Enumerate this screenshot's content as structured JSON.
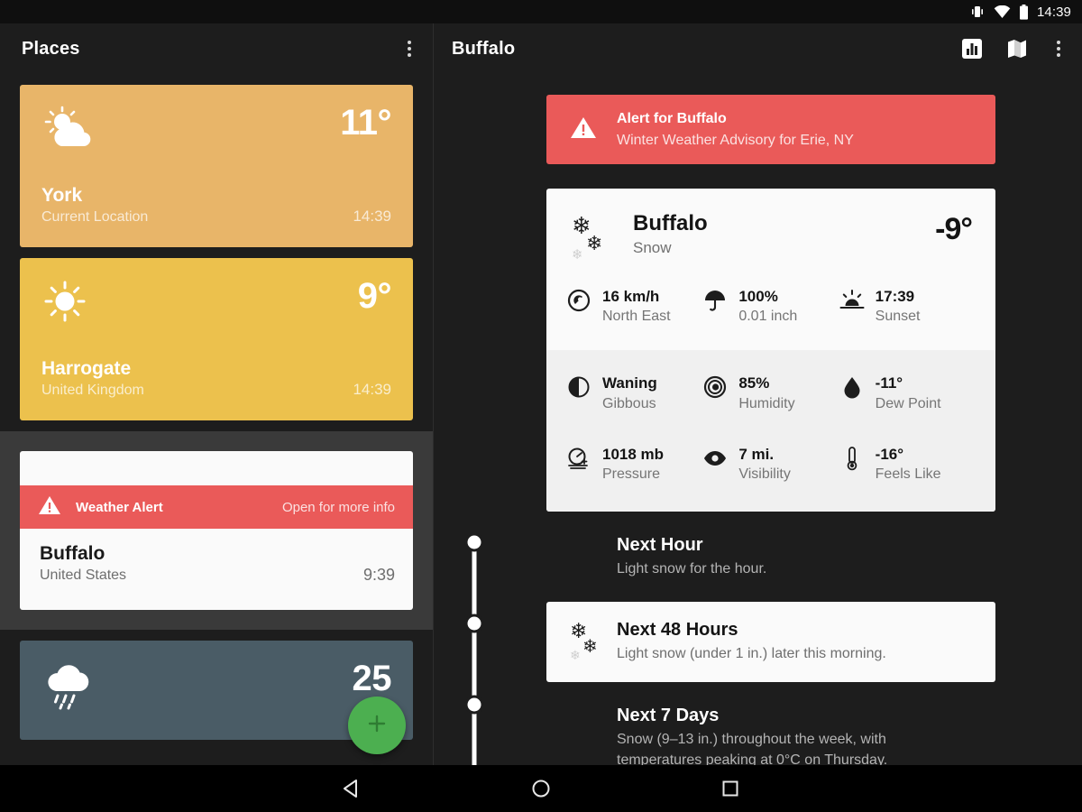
{
  "status_bar": {
    "time": "14:39",
    "icons": [
      "vibrate-icon",
      "wifi-icon",
      "battery-icon"
    ]
  },
  "left_panel": {
    "toolbar": {
      "title": "Places",
      "overflow_icon": "overflow-menu-icon"
    },
    "places": [
      {
        "name": "York",
        "subtitle": "Current Location",
        "temperature": "11°",
        "time": "14:39",
        "icon": "partly-cloudy-icon",
        "color": "#E8B569",
        "selected": false
      },
      {
        "name": "Harrogate",
        "subtitle": "United Kingdom",
        "temperature": "9°",
        "time": "14:39",
        "icon": "sun-icon",
        "color": "#ECC14D",
        "selected": false
      },
      {
        "name": "Buffalo",
        "subtitle": "United States",
        "time": "9:39",
        "alert_label": "Weather Alert",
        "alert_action": "Open for more info",
        "alert_color": "#EA5A59",
        "selected": true
      },
      {
        "name": "",
        "subtitle": "",
        "temperature": "25",
        "icon": "rain-icon",
        "color": "#4A5C66",
        "selected": false
      }
    ],
    "fab": {
      "icon": "plus-icon",
      "color": "#4CAF50"
    }
  },
  "right_panel": {
    "toolbar": {
      "title": "Buffalo",
      "actions": [
        "chart-icon",
        "map-icon",
        "overflow-menu-icon"
      ]
    },
    "alert": {
      "icon": "warning-icon",
      "title": "Alert for Buffalo",
      "subtitle": "Winter Weather Advisory for Erie, NY",
      "color": "#EA5A59"
    },
    "current": {
      "icon": "snow-icon",
      "city": "Buffalo",
      "condition": "Snow",
      "temperature": "-9°"
    },
    "metrics_primary": [
      {
        "icon": "wind-icon",
        "value": "16 km/h",
        "label": "North East"
      },
      {
        "icon": "umbrella-icon",
        "value": "100%",
        "label": "0.01 inch"
      },
      {
        "icon": "sunset-icon",
        "value": "17:39",
        "label": "Sunset"
      }
    ],
    "metrics_secondary": [
      {
        "icon": "moon-icon",
        "value": "Waning",
        "label": "Gibbous"
      },
      {
        "icon": "humidity-icon",
        "value": "85%",
        "label": "Humidity"
      },
      {
        "icon": "dewpoint-icon",
        "value": "-11°",
        "label": "Dew Point"
      },
      {
        "icon": "pressure-icon",
        "value": "1018 mb",
        "label": "Pressure"
      },
      {
        "icon": "visibility-icon",
        "value": "7 mi.",
        "label": "Visibility"
      },
      {
        "icon": "thermometer-icon",
        "value": "-16°",
        "label": "Feels Like"
      }
    ],
    "forecasts": [
      {
        "title": "Next Hour",
        "description": "Light snow for the hour.",
        "theme": "dark",
        "icon": null
      },
      {
        "title": "Next 48 Hours",
        "description": "Light snow (under 1 in.) later this morning.",
        "theme": "light",
        "icon": "snow-icon"
      },
      {
        "title": "Next 7 Days",
        "description": "Snow (9–13 in.) throughout the week, with temperatures peaking at 0°C on Thursday.",
        "theme": "dark",
        "icon": null
      }
    ]
  },
  "nav_bar": {
    "buttons": [
      "back-icon",
      "home-icon",
      "recents-icon"
    ]
  }
}
